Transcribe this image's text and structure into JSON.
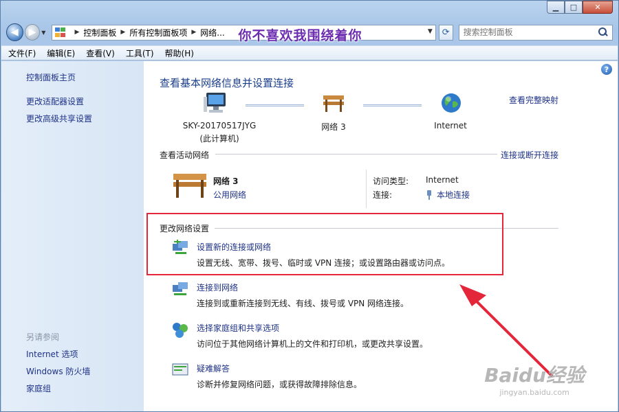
{
  "window": {
    "minimize": "▁",
    "maximize": "□",
    "close": "✕"
  },
  "nav": {
    "back_glyph": "◀",
    "forward_glyph": "▶",
    "breadcrumb": [
      "控制面板",
      "所有控制面板项",
      "网络..."
    ],
    "overlay_text": "你不喜欢我围绕着你",
    "search_placeholder": "搜索控制面板"
  },
  "menu": [
    "文件(F)",
    "编辑(E)",
    "查看(V)",
    "工具(T)",
    "帮助(H)"
  ],
  "sidebar": {
    "links": [
      "控制面板主页",
      "更改适配器设置",
      "更改高级共享设置"
    ],
    "see_also_title": "另请参阅",
    "see_also": [
      "Internet 选项",
      "Windows 防火墙",
      "家庭组"
    ]
  },
  "main": {
    "help": "?",
    "title": "查看基本网络信息并设置连接",
    "full_map": "查看完整映射",
    "map": {
      "computer_name": "SKY-20170517JYG",
      "computer_sub": "(此计算机)",
      "network": "网络  3",
      "internet": "Internet"
    },
    "active_title": "查看活动网络",
    "connect_disconnect": "连接或断开连接",
    "active": {
      "name": "网络  3",
      "type": "公用网络",
      "access_key": "访问类型:",
      "access_val": "Internet",
      "conn_key": "连接:",
      "conn_val": "本地连接"
    },
    "change_title": "更改网络设置",
    "tasks": [
      {
        "link": "设置新的连接或网络",
        "desc": "设置无线、宽带、拨号、临时或 VPN 连接；或设置路由器或访问点。"
      },
      {
        "link": "连接到网络",
        "desc": "连接到或重新连接到无线、有线、拨号或 VPN 网络连接。"
      },
      {
        "link": "选择家庭组和共享选项",
        "desc": "访问位于其他网络计算机上的文件和打印机，或更改共享设置。"
      },
      {
        "link": "疑难解答",
        "desc": "诊断并修复网络问题，或获得故障排除信息。"
      }
    ]
  },
  "watermark": {
    "brand": "Baidu经验",
    "url": "jingyan.baidu.com"
  },
  "colors": {
    "link": "#1e3287",
    "title": "#1a3e8c",
    "highlight": "#e3263a"
  }
}
